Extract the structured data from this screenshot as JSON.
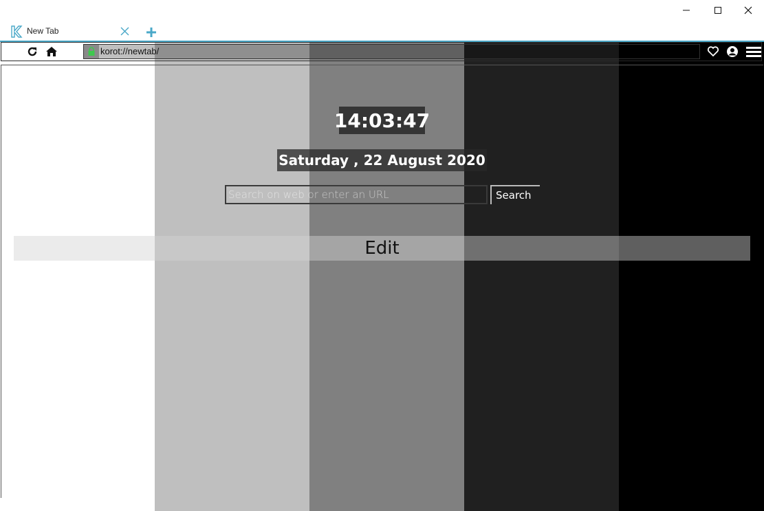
{
  "window": {
    "minimize_icon": "minimize-icon",
    "maximize_icon": "maximize-icon",
    "close_icon": "close-icon"
  },
  "tabs": {
    "active": {
      "title": "New Tab",
      "favicon": "korot-logo-icon"
    },
    "new_tab_icon": "plus-icon"
  },
  "toolbar": {
    "url": "korot://newtab/",
    "lock_icon": "lock-icon",
    "reload_icon": "reload-icon",
    "home_icon": "home-icon",
    "favorites_icon": "heart-icon",
    "profile_icon": "profile-icon",
    "menu_icon": "hamburger-menu-icon"
  },
  "page": {
    "time": "14:03:47",
    "date": "Saturday , 22 August 2020",
    "search_placeholder": "Search on web or enter an URL",
    "search_button": "Search",
    "edit_label": "Edit"
  },
  "colors": {
    "accent": "#4aa8c8",
    "lock": "#3ec84e",
    "stripes": [
      "#ffffff",
      "#bfbfbf",
      "#808080",
      "#202020",
      "#000000"
    ]
  }
}
